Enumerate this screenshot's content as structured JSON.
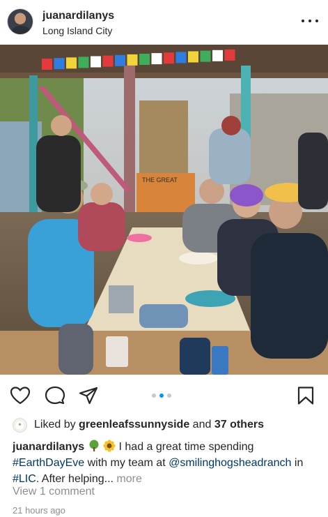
{
  "post": {
    "username": "juanardilanys",
    "location": "Long Island City"
  },
  "photo": {
    "prayer_flag_colors": [
      "#e33b3b",
      "#2f7de0",
      "#f2d43a",
      "#3fae5a",
      "#ffffff",
      "#e33b3b",
      "#2f7de0",
      "#f2d43a",
      "#3fae5a",
      "#ffffff",
      "#e33b3b",
      "#2f7de0",
      "#f2d43a",
      "#3fae5a",
      "#ffffff",
      "#e33b3b"
    ],
    "cooler_label": "THE GREAT"
  },
  "carousel": {
    "count": 3,
    "active_index": 1,
    "active_color": "#0095f6",
    "inactive_color": "#c7c7c7"
  },
  "likes": {
    "prefix": "Liked by",
    "user": "greenleafssunnyside",
    "conjunction": "and",
    "others": "37 others"
  },
  "caption": {
    "username": "juanardilanys",
    "emojis": [
      "tree",
      "sunflower"
    ],
    "text1": " I had a great time spending ",
    "hashtag1": "#EarthDayEve",
    "text2": " with my team at ",
    "mention": "@smilinghogsheadranch",
    "text3": " in ",
    "hashtag2": "#LIC",
    "text4": ". After helping... ",
    "more": "more"
  },
  "comments": {
    "view": "View 1 comment"
  },
  "timestamp": "21 hours ago",
  "icons": [
    "heart-icon",
    "comment-icon",
    "share-icon",
    "bookmark-icon",
    "more-icon"
  ],
  "colors": {
    "link": "#00376b",
    "muted": "#8e8e8e",
    "text": "#262626"
  }
}
